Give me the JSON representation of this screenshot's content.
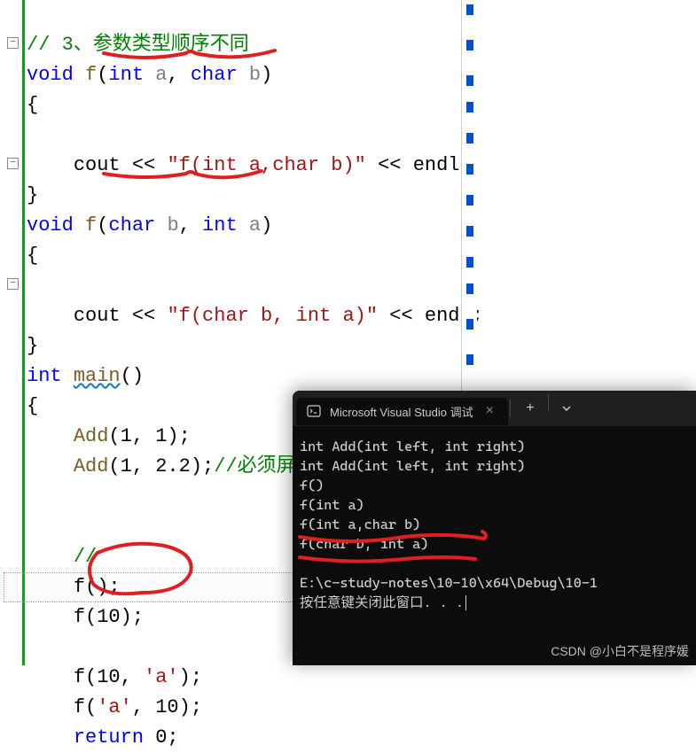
{
  "code": {
    "comment_top": "// 3、参数类型顺序不同",
    "line2_void": "void",
    "line2_f": "f",
    "line2_int": "int",
    "line2_a": "a",
    "line2_char": "char",
    "line2_b": "b",
    "cout1_cout": "cout",
    "cout1_op": "<<",
    "cout1_str": "\"f(int a,char b)\"",
    "cout1_endl": "endl",
    "line7_void": "void",
    "line7_f": "f",
    "line7_char": "char",
    "line7_b": "b",
    "line7_int": "int",
    "line7_a": "a",
    "cout2_str": "\"f(char b, int a)\"",
    "main_int": "int",
    "main_main": "main",
    "add1": "Add",
    "add1_args": "(1, 1);",
    "add2": "Add",
    "add2_args": "(1, 2.2);",
    "add2_comment": "//必须屏蔽一个函数，整形提升",
    "slashslash": "//",
    "f_call1": "f();",
    "f_call2": "f(10);",
    "f_call3_pre": "f(10, ",
    "f_call3_char": "'a'",
    "f_call3_post": ");",
    "f_call4_pre": "f(",
    "f_call4_char": "'a'",
    "f_call4_post": ", 10);",
    "return_kw": "return",
    "return_val": " 0;"
  },
  "terminal": {
    "title": "Microsoft Visual Studio 调试",
    "lines": {
      "l1": "int Add(int left, int right)",
      "l2": "int Add(int left, int right)",
      "l3": "f()",
      "l4": "f(int a)",
      "l5": "f(int a,char b)",
      "l6": "f(char b, int a)",
      "blank": "",
      "path": "E:\\c-study-notes\\10-10\\x64\\Debug\\10-1",
      "prompt": "按任意键关闭此窗口. . ."
    }
  },
  "watermark": "CSDN @小白不是程序媛"
}
